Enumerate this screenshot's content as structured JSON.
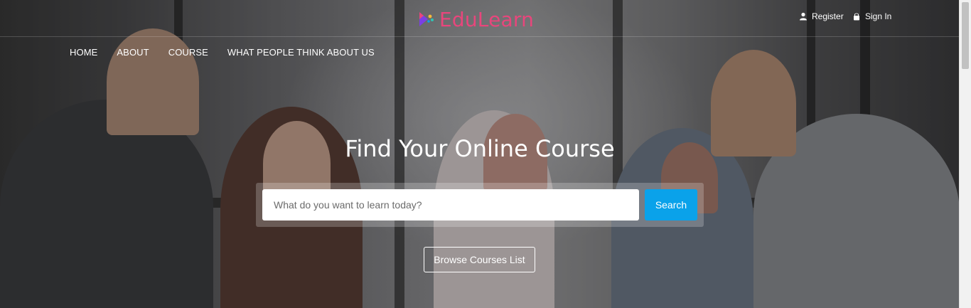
{
  "brand": {
    "name": "EduLearn",
    "color": "#e8467c"
  },
  "header": {
    "register_label": "Register",
    "signin_label": "Sign In",
    "register_icon": "user-icon",
    "signin_icon": "lock-icon"
  },
  "nav": {
    "items": [
      {
        "label": "HOME"
      },
      {
        "label": "ABOUT"
      },
      {
        "label": "COURSE"
      },
      {
        "label": "WHAT PEOPLE THINK ABOUT US"
      }
    ]
  },
  "hero": {
    "title": "Find Your Online Course",
    "search_placeholder": "What do you want to learn today?",
    "search_value": "",
    "search_button": "Search",
    "browse_button": "Browse Courses List",
    "accent_color": "#0aa2ea"
  }
}
